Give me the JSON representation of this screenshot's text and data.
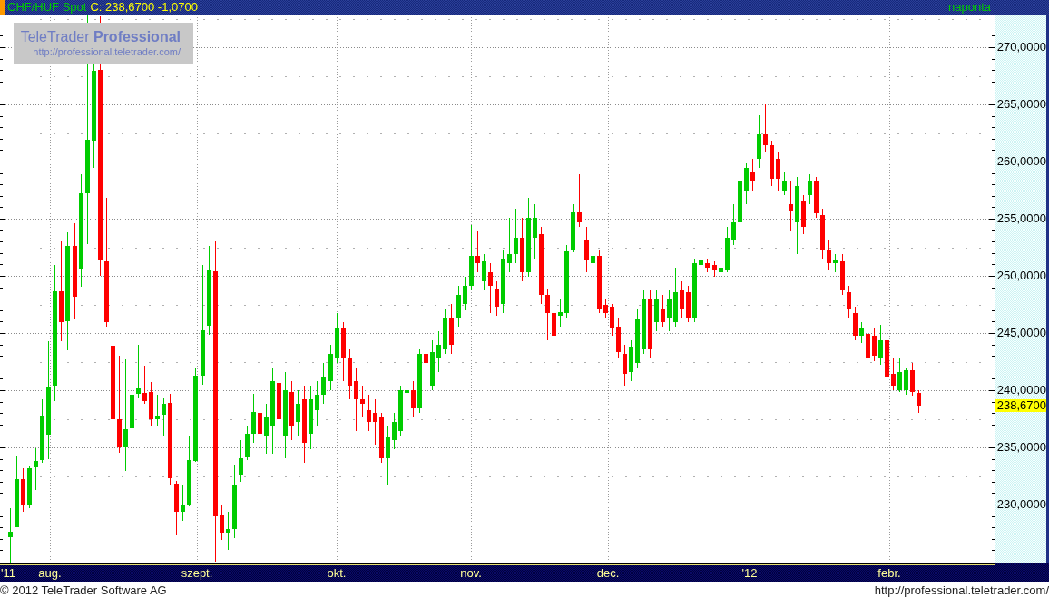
{
  "header": {
    "symbol": "CHF/HUF Spot",
    "quote": "C: 238,6700 -1,0700",
    "interval": "naponta"
  },
  "chart": {
    "logo": {
      "title": "TeleTrader **Professional**",
      "url": "http://professional.teletrader.com/"
    },
    "y_axis": {
      "labels": [
        "270,0000",
        "265,0000",
        "260,0000",
        "255,0000",
        "250,0000",
        "245,0000",
        "240,0000",
        "235,0000",
        "230,0000"
      ],
      "last_price": "238,6700"
    },
    "x_axis": {
      "labels": [
        "'11",
        "aug.",
        "szept.",
        "okt.",
        "nov.",
        "dec.",
        "'12",
        "febr."
      ]
    }
  },
  "footer": {
    "copyright": "© 2012 TeleTrader Software AG",
    "url": "http://professional.teletrader.com/"
  }
}
